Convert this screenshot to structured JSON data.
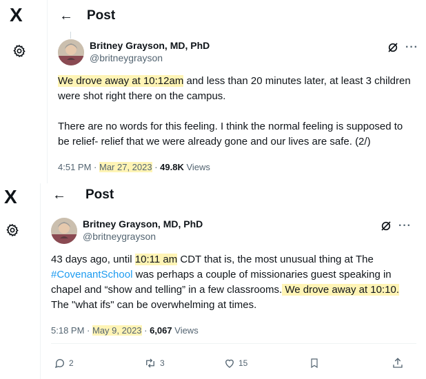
{
  "brand": {
    "logo_char": "X"
  },
  "header": {
    "back_icon": "back-arrow-icon",
    "title": "Post"
  },
  "posts": [
    {
      "author": {
        "name": "Britney Grayson, MD, PhD",
        "handle": "@britneygrayson"
      },
      "text": {
        "hl1": "We drove away at 10:12am",
        "rest1": " and less than 20 minutes later, at least 3 children were shot right there on the campus.",
        "para2": "There are no words for this feeling. I think the normal feeling is supposed to be relief- relief that we were already gone and our lives are safe. (2/)"
      },
      "meta": {
        "time": "4:51 PM",
        "sep": " · ",
        "date": "Mar 27, 2023",
        "views_count": "49.8K",
        "views_label": " Views"
      }
    },
    {
      "author": {
        "name": "Britney Grayson, MD, PhD",
        "handle": "@britneygrayson"
      },
      "text": {
        "t1": "43 days ago, until ",
        "hl1": "10:11 am",
        "t2": " CDT that is, the most unusual thing at The ",
        "hashtag": "#CovenantSchool",
        "t3": " was perhaps a couple of missionaries guest speaking in chapel and “show and telling” in a few classrooms.",
        "hl2": " We drove away at 10:10.",
        "t4": " The \"what ifs\" can be overwhelming at times."
      },
      "meta": {
        "time": "5:18 PM",
        "sep": " · ",
        "date": "May 9, 2023",
        "views_count": "6,067",
        "views_label": " Views"
      },
      "actions": {
        "replies": "2",
        "reposts": "3",
        "likes": "15"
      }
    }
  ]
}
